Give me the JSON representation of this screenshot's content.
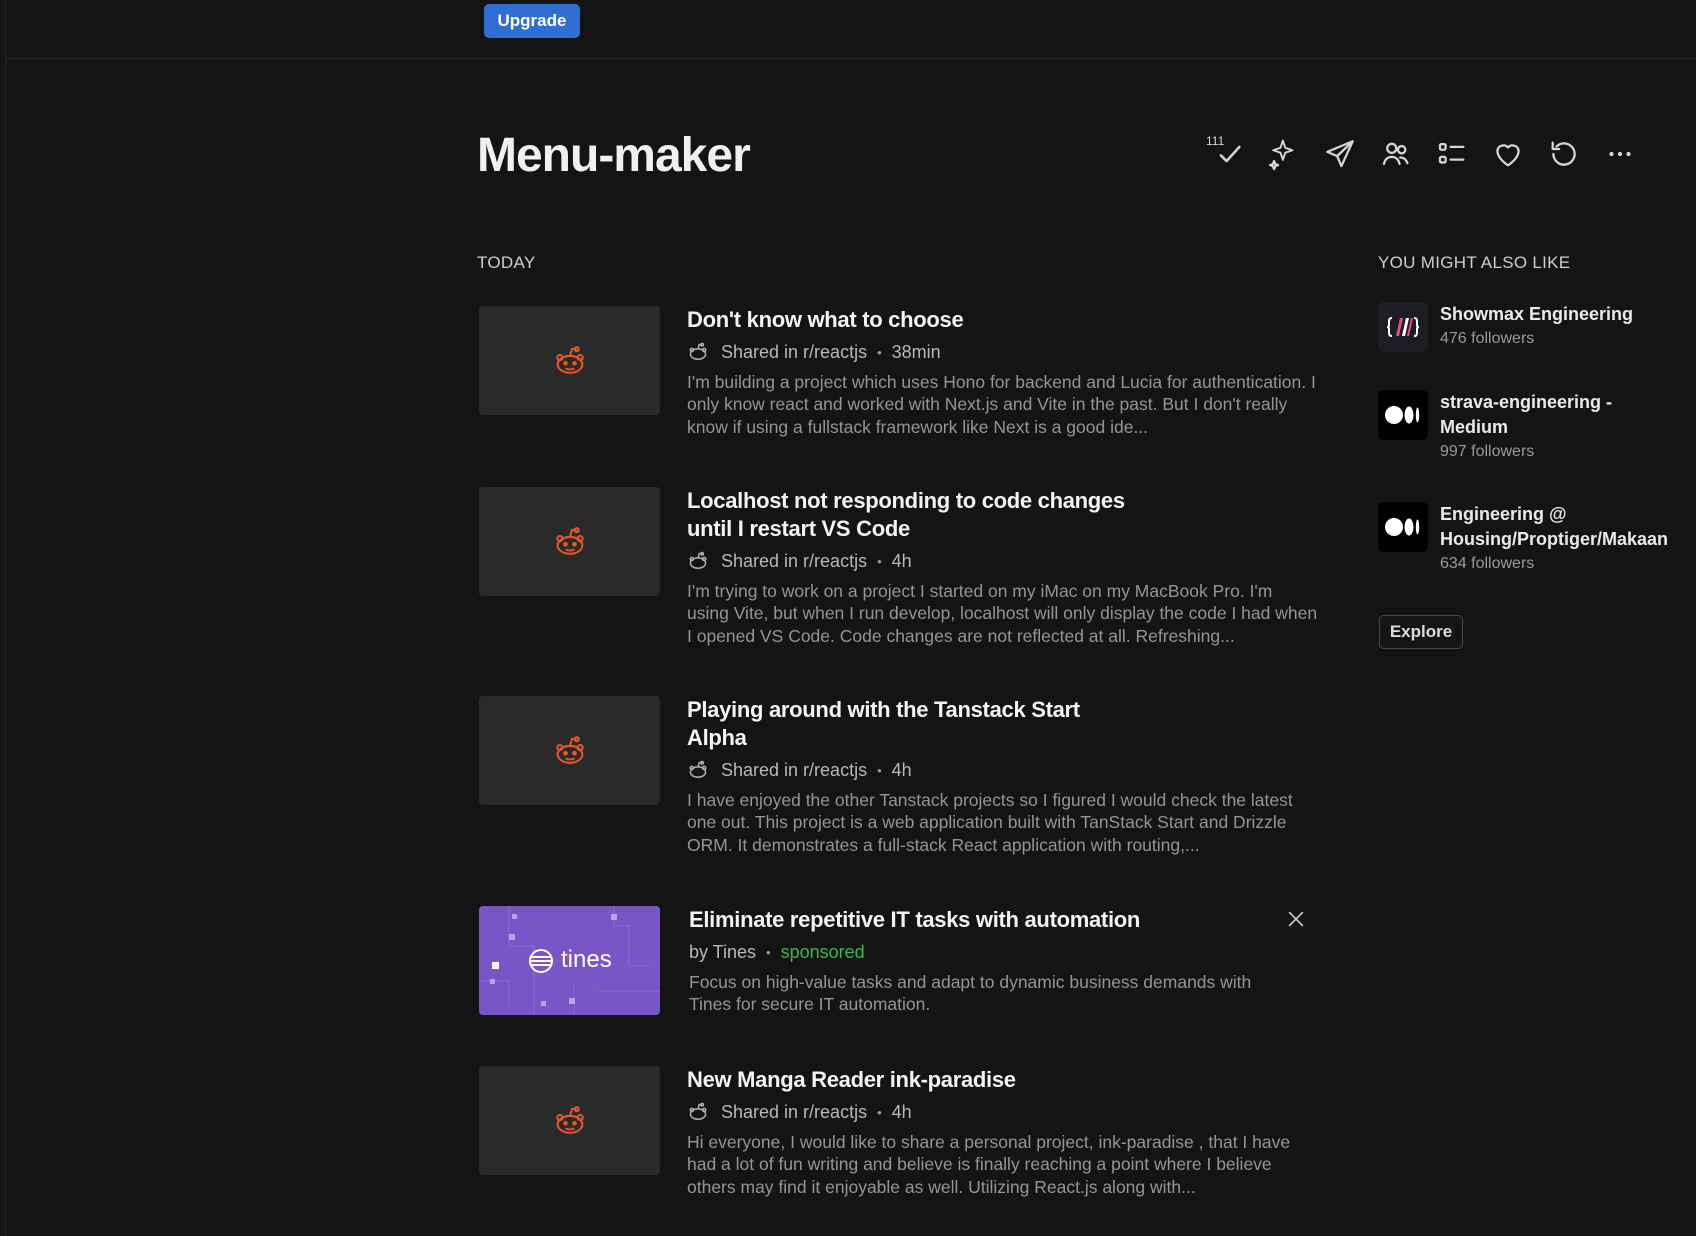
{
  "topbar": {
    "upgrade_label": "Upgrade"
  },
  "page": {
    "title": "Menu-maker"
  },
  "toolbar": {
    "mark_read_count": "111",
    "icons": [
      "check-icon",
      "sparkle-icon",
      "send-icon",
      "people-icon",
      "list-icon",
      "heart-icon",
      "refresh-icon",
      "more-icon"
    ]
  },
  "feed": {
    "section_label": "TODAY",
    "items": [
      {
        "title": "Don't know what to choose",
        "source": "Shared in r/reactjs",
        "time": "38min",
        "excerpt": "I'm building a project which uses Hono for backend and Lucia for authentication. I only know react and worked with Next.js and Vite in the past. But I don't really know if using a fullstack framework like Next is a good ide..."
      },
      {
        "title": "Localhost not responding to code changes until I restart VS Code",
        "source": "Shared in r/reactjs",
        "time": "4h",
        "excerpt": "I'm trying to work on a project I started on my iMac on my MacBook Pro. I'm using Vite, but when I run develop, localhost will only display the code I had when I opened VS Code. Code changes are not reflected at all. Refreshing..."
      },
      {
        "title": "Playing around with the Tanstack Start Alpha",
        "source": "Shared in r/reactjs",
        "time": "4h",
        "excerpt": "I have enjoyed the other Tanstack projects so I figured I would check the latest one out. This project is a web application built with TanStack Start and Drizzle ORM. It demonstrates a full-stack React application with routing,..."
      },
      {
        "title": "Eliminate repetitive IT tasks with automation",
        "source": "by Tines",
        "tag": "sponsored",
        "thumb_label": "tines",
        "excerpt": "Focus on high-value tasks and adapt to dynamic business demands with Tines for secure IT automation."
      },
      {
        "title": "New Manga Reader ink-paradise",
        "source": "Shared in r/reactjs",
        "time": "4h",
        "excerpt": "Hi everyone, I would like to share a personal project, ink-paradise , that I have had a lot of fun writing and believe is finally reaching a point where I believe others may find it enjoyable as well. Utilizing React.js along with..."
      }
    ]
  },
  "suggestions": {
    "section_label": "YOU MIGHT ALSO LIKE",
    "items": [
      {
        "name": "Showmax Engineering",
        "followers": "476 followers",
        "avatar": "showmax-logo"
      },
      {
        "name": "strava-engineering - Medium",
        "followers": "997 followers",
        "avatar": "medium-logo"
      },
      {
        "name": "Engineering @ Housing/Proptiger/Makaan",
        "followers": "634 followers",
        "avatar": "medium-logo"
      }
    ],
    "explore_label": "Explore"
  },
  "colors": {
    "background": "#141414",
    "accent": "#2f6fd1",
    "reddit_orange": "#e5572a",
    "sponsored_green": "#3cb94a",
    "tines_purple": "#7856c7"
  }
}
